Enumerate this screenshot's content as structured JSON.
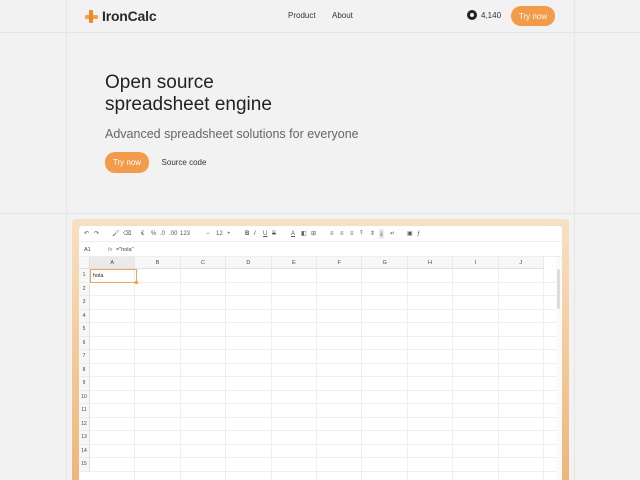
{
  "nav": {
    "logo_text": "IronCalc",
    "links": [
      "Product",
      "About"
    ],
    "github_count": "4,140",
    "try_now": "Try now"
  },
  "hero": {
    "title_line1": "Open source",
    "title_line2": "spreadsheet engine",
    "subtitle": "Advanced spreadsheet solutions for everyone",
    "try_now": "Try now",
    "source_code": "Source code"
  },
  "app": {
    "toolbar": {
      "undo": "↶",
      "redo": "↷",
      "paint": "🖌",
      "clear_format": "⌫",
      "currency": "€",
      "percent": "%",
      "dec_decrease": ".0",
      "dec_increase": ".00",
      "number_format": "123",
      "font_decrease": "−",
      "font_size": "12",
      "font_increase": "+",
      "bold": "B",
      "italic": "I",
      "underline": "U",
      "strike": "S",
      "text_color": "A",
      "fill": "◧",
      "borders": "⊞",
      "align_left": "≡",
      "align_center": "≡",
      "align_right": "≡",
      "valign_top": "⤒",
      "valign_middle": "⇕",
      "valign_bottom": "⤓",
      "wrap": "↵",
      "image": "▣",
      "function": "ƒ"
    },
    "formula_bar": {
      "cell_ref": "A1",
      "fx": "fx",
      "value": "=\"hola\""
    },
    "columns": [
      "A",
      "B",
      "C",
      "D",
      "E",
      "F",
      "G",
      "H",
      "I",
      "J"
    ],
    "rows": [
      "1",
      "2",
      "3",
      "4",
      "5",
      "6",
      "7",
      "8",
      "9",
      "10",
      "11",
      "12",
      "13",
      "14",
      "15"
    ],
    "cell_a1": "hola"
  },
  "colors": {
    "accent": "#f29b4b",
    "selection": "#f0a658",
    "background": "#f2f2f2"
  }
}
